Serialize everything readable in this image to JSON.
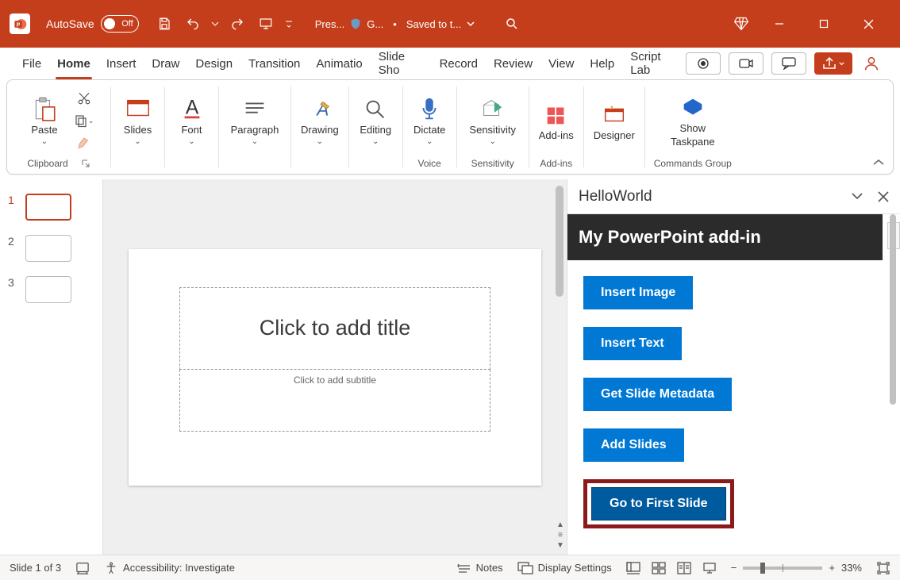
{
  "titlebar": {
    "autosave_label": "AutoSave",
    "autosave_state": "Off",
    "filename_short": "Pres...",
    "account_short": "G...",
    "save_status": "Saved to t..."
  },
  "tabs": {
    "items": [
      "File",
      "Home",
      "Insert",
      "Draw",
      "Design",
      "Transition",
      "Animatio",
      "Slide Sho",
      "Record",
      "Review",
      "View",
      "Help",
      "Script Lab"
    ],
    "active_index": 1
  },
  "ribbon": {
    "clipboard": {
      "paste": "Paste",
      "group_label": "Clipboard"
    },
    "slides": {
      "label": "Slides"
    },
    "font": {
      "label": "Font"
    },
    "paragraph": {
      "label": "Paragraph"
    },
    "drawing": {
      "label": "Drawing"
    },
    "editing": {
      "label": "Editing"
    },
    "dictate": {
      "label": "Dictate",
      "group_label": "Voice"
    },
    "sensitivity": {
      "label": "Sensitivity",
      "group_label": "Sensitivity"
    },
    "addins": {
      "label": "Add-ins",
      "group_label": "Add-ins"
    },
    "designer": {
      "label": "Designer"
    },
    "taskpane": {
      "label1": "Show",
      "label2": "Taskpane",
      "group_label": "Commands Group"
    }
  },
  "thumbnails": {
    "count": 3,
    "active_index": 0
  },
  "slide": {
    "title_placeholder": "Click to add title",
    "subtitle_placeholder": "Click to add subtitle"
  },
  "taskpane": {
    "title": "HelloWorld",
    "addin_title": "My PowerPoint add-in",
    "buttons": [
      "Insert Image",
      "Insert Text",
      "Get Slide Metadata",
      "Add Slides",
      "Go to First Slide"
    ],
    "highlighted_index": 4
  },
  "statusbar": {
    "slide_counter": "Slide 1 of 3",
    "accessibility": "Accessibility: Investigate",
    "notes": "Notes",
    "display_settings": "Display Settings",
    "zoom_pct": "33%"
  },
  "colors": {
    "brand": "#c43e1c",
    "button_blue": "#0078d4",
    "highlight_border": "#8b1a1a"
  }
}
